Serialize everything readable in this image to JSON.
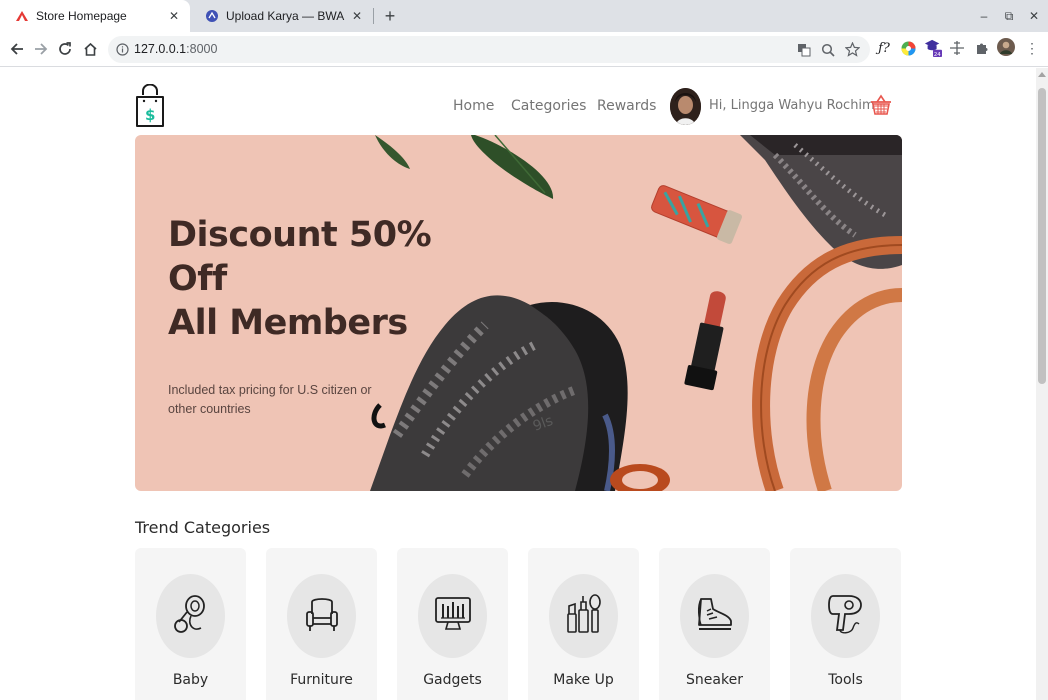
{
  "browser": {
    "tabs": [
      {
        "title": "Store Homepage",
        "active": true
      },
      {
        "title": "Upload Karya — BWA",
        "active": false
      }
    ],
    "url_host": "127.0.0.1",
    "url_port": ":8000"
  },
  "header": {
    "nav": [
      "Home",
      "Categories",
      "Rewards"
    ],
    "greeting": "Hi, Lingga Wahyu Rochim"
  },
  "hero": {
    "title_line1": "Discount 50% Off",
    "title_line2": "All Members",
    "subtitle": "Included tax pricing for U.S citizen or other countries",
    "slides": 3,
    "active_slide": 3,
    "background": "#efc4b5"
  },
  "categories_section": {
    "title": "Trend Categories",
    "items": [
      {
        "label": "Baby",
        "icon": "pacifier-icon"
      },
      {
        "label": "Furniture",
        "icon": "armchair-icon"
      },
      {
        "label": "Gadgets",
        "icon": "monitor-icon"
      },
      {
        "label": "Make Up",
        "icon": "makeup-icon"
      },
      {
        "label": "Sneaker",
        "icon": "sneaker-icon"
      },
      {
        "label": "Tools",
        "icon": "hairdryer-icon"
      }
    ]
  },
  "colors": {
    "accent": "#e8574e",
    "logo": "#1abc9c",
    "text": "#757575"
  }
}
